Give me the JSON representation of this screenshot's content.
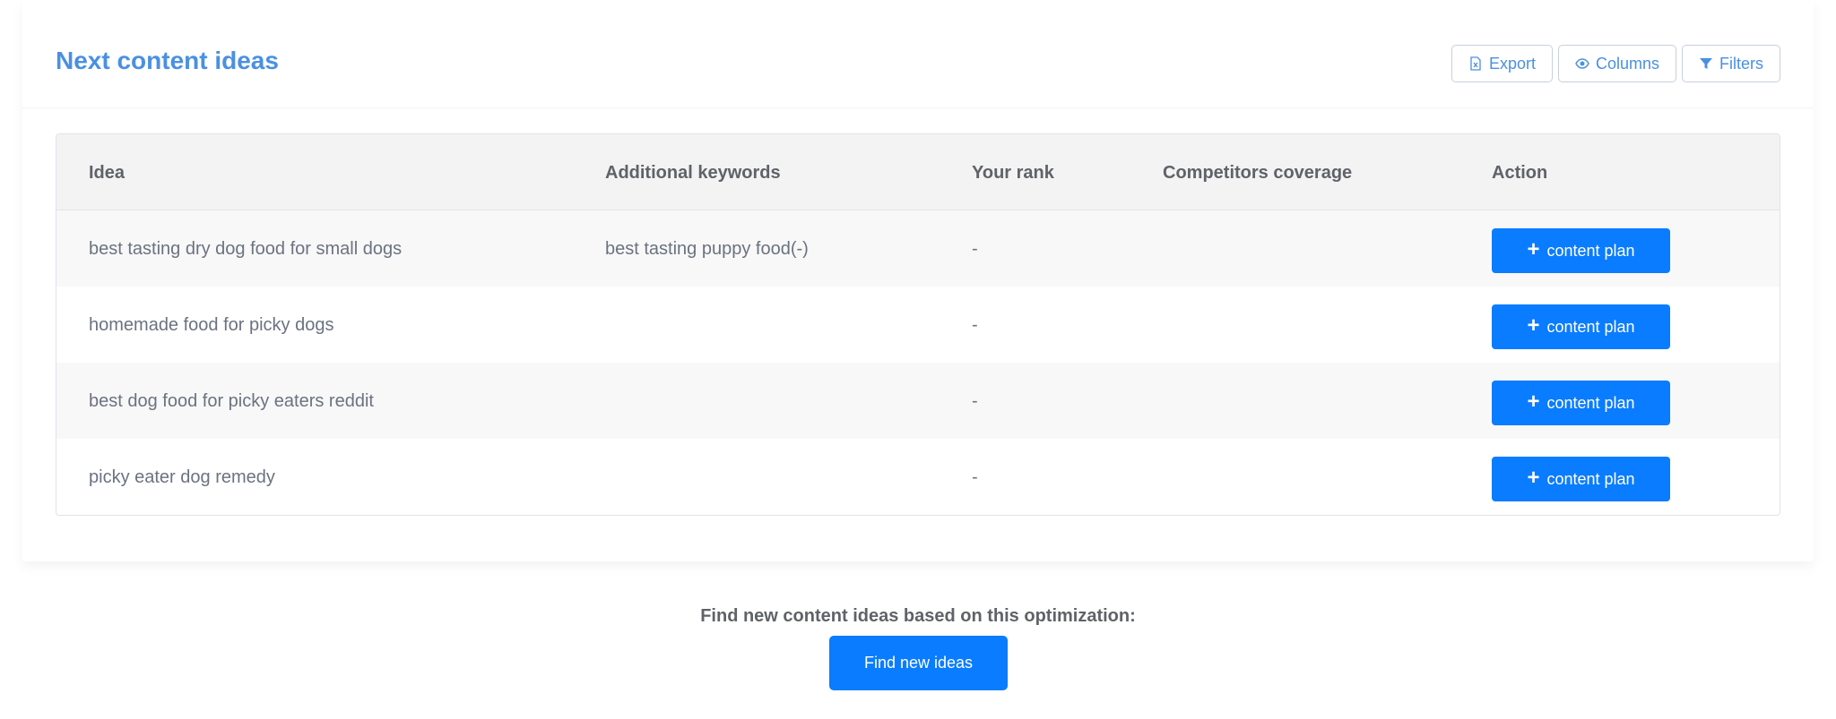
{
  "section": {
    "title": "Next content ideas"
  },
  "toolbar": {
    "export_label": "Export",
    "columns_label": "Columns",
    "filters_label": "Filters",
    "export_icon": "excel-file-icon",
    "columns_icon": "eye-icon",
    "filters_icon": "funnel-icon"
  },
  "table": {
    "headers": [
      "Idea",
      "Additional keywords",
      "Your rank",
      "Competitors coverage",
      "Action"
    ],
    "rows": [
      {
        "idea": "best tasting dry dog food for small dogs",
        "keywords": "best tasting puppy food(-)",
        "rank": "-",
        "coverage": "",
        "action": "content plan"
      },
      {
        "idea": "homemade food for picky dogs",
        "keywords": "",
        "rank": "-",
        "coverage": "",
        "action": "content plan"
      },
      {
        "idea": "best dog food for picky eaters reddit",
        "keywords": "",
        "rank": "-",
        "coverage": "",
        "action": "content plan"
      },
      {
        "idea": "picky eater dog remedy",
        "keywords": "",
        "rank": "-",
        "coverage": "",
        "action": "content plan"
      }
    ]
  },
  "footer": {
    "find_label": "Find new content ideas based on this optimization:",
    "find_button": "Find new ideas"
  },
  "colors": {
    "accent": "#4a90e2",
    "primary_button": "#0a7cff"
  }
}
